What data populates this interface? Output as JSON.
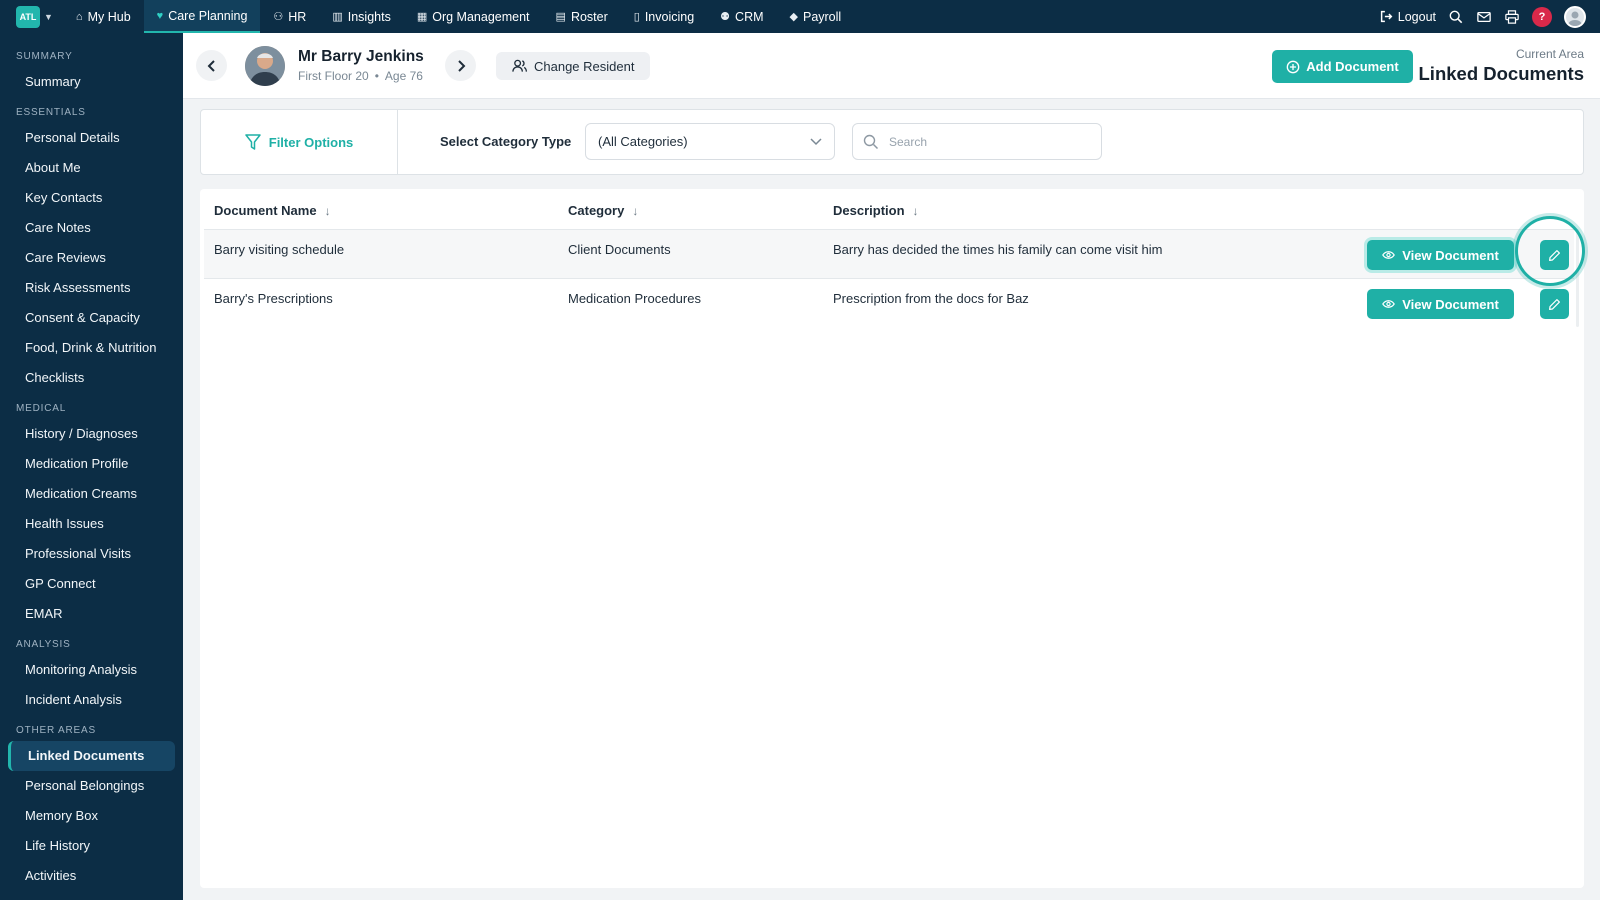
{
  "brand": {
    "logo_text": "ATL"
  },
  "topnav": [
    {
      "label": "My Hub",
      "icon": "home-icon",
      "glyph": "⌂"
    },
    {
      "label": "Care Planning",
      "icon": "heart-icon",
      "glyph": "♥",
      "active": true
    },
    {
      "label": "HR",
      "icon": "people-icon",
      "glyph": "⚇"
    },
    {
      "label": "Insights",
      "icon": "chart-icon",
      "glyph": "▥"
    },
    {
      "label": "Org Management",
      "icon": "building-icon",
      "glyph": "▦"
    },
    {
      "label": "Roster",
      "icon": "calendar-icon",
      "glyph": "▤"
    },
    {
      "label": "Invoicing",
      "icon": "invoice-icon",
      "glyph": "▯"
    },
    {
      "label": "CRM",
      "icon": "contacts-icon",
      "glyph": "⚉"
    },
    {
      "label": "Payroll",
      "icon": "payroll-icon",
      "glyph": "◆"
    }
  ],
  "topright": {
    "logout": "Logout",
    "help": "?"
  },
  "sidebar": {
    "sections": [
      {
        "title": "SUMMARY",
        "items": [
          "Summary"
        ]
      },
      {
        "title": "ESSENTIALS",
        "items": [
          "Personal Details",
          "About Me",
          "Key Contacts",
          "Care Notes",
          "Care Reviews",
          "Risk Assessments",
          "Consent & Capacity",
          "Food, Drink & Nutrition",
          "Checklists"
        ]
      },
      {
        "title": "MEDICAL",
        "items": [
          "History / Diagnoses",
          "Medication Profile",
          "Medication Creams",
          "Health Issues",
          "Professional Visits",
          "GP Connect",
          "EMAR"
        ]
      },
      {
        "title": "ANALYSIS",
        "items": [
          "Monitoring Analysis",
          "Incident Analysis"
        ]
      },
      {
        "title": "OTHER AREAS",
        "items": [
          "Linked Documents",
          "Personal Belongings",
          "Memory Box",
          "Life History",
          "Activities"
        ]
      }
    ],
    "active": "Linked Documents"
  },
  "resident": {
    "name": "Mr Barry Jenkins",
    "location": "First Floor 20",
    "age": "Age 76"
  },
  "header": {
    "change_resident": "Change Resident",
    "add_document": "Add Document",
    "current_area_label": "Current Area",
    "current_area": "Linked Documents"
  },
  "filter": {
    "filter_options": "Filter Options",
    "category_label": "Select Category Type",
    "category_value": "(All Categories)",
    "search_placeholder": "Search"
  },
  "table": {
    "columns": [
      "Document Name",
      "Category",
      "Description"
    ],
    "rows": [
      {
        "name": "Barry visiting schedule",
        "category": "Client Documents",
        "description": "Barry has decided the times his family can come visit him"
      },
      {
        "name": "Barry's Prescriptions",
        "category": "Medication Procedures",
        "description": "Prescription from the docs for Baz"
      }
    ],
    "view_label": "View Document"
  },
  "colors": {
    "nav_bg": "#0c2d45",
    "accent": "#1fb0a6",
    "help_badge": "#d9294a"
  }
}
